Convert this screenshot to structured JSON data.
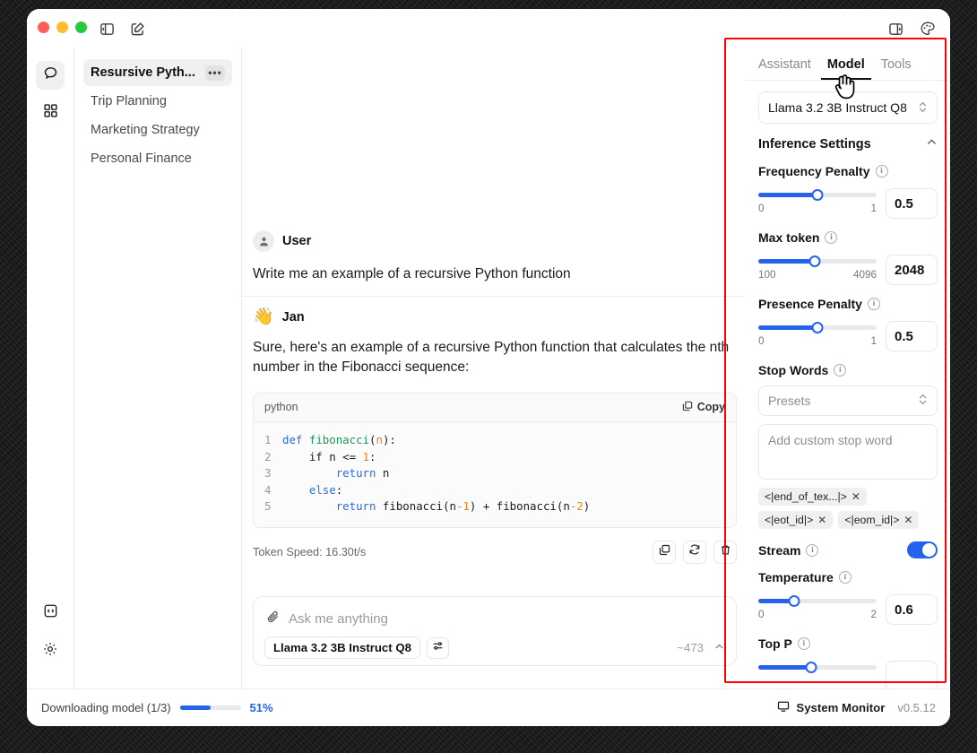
{
  "titlebar": {
    "icons": [
      "panel-left-icon",
      "compose-icon",
      "panel-right-icon",
      "palette-icon"
    ]
  },
  "rail": {
    "items": [
      {
        "name": "chat-icon",
        "active": true
      },
      {
        "name": "apps-grid-icon",
        "active": false
      }
    ],
    "bottom": [
      {
        "name": "code-icon"
      },
      {
        "name": "gear-icon"
      }
    ]
  },
  "threads": {
    "items": [
      {
        "label": "Resursive Pyth...",
        "active": true,
        "menu": "•••"
      },
      {
        "label": "Trip Planning",
        "active": false
      },
      {
        "label": "Marketing Strategy",
        "active": false
      },
      {
        "label": "Personal Finance",
        "active": false
      }
    ]
  },
  "chat": {
    "user": {
      "name": "User",
      "text": "Write me an example of a recursive Python function"
    },
    "assistant": {
      "emoji": "👋",
      "name": "Jan",
      "text": "Sure, here's an example of a recursive Python function that calculates the nth number in the Fibonacci sequence:",
      "code": {
        "language": "python",
        "copy_label": "Copy",
        "lines": [
          "1",
          "2",
          "3",
          "4",
          "5"
        ]
      },
      "token_speed": "Token Speed: 16.30t/s",
      "actions": [
        "copy-icon",
        "regenerate-icon",
        "delete-icon"
      ]
    }
  },
  "composer": {
    "placeholder": "Ask me anything",
    "model": "Llama 3.2 3B Instruct Q8",
    "token_count": "~473"
  },
  "panel": {
    "tabs": [
      {
        "label": "Assistant",
        "active": false
      },
      {
        "label": "Model",
        "active": true
      },
      {
        "label": "Tools",
        "active": false
      }
    ],
    "model_select": "Llama 3.2 3B Instruct Q8",
    "section_title": "Inference Settings",
    "settings": [
      {
        "label": "Frequency Penalty",
        "min": "0",
        "max": "1",
        "value": "0.5",
        "fill_pct": 50
      },
      {
        "label": "Max token",
        "min": "100",
        "max": "4096",
        "value": "2048",
        "fill_pct": 48
      },
      {
        "label": "Presence Penalty",
        "min": "0",
        "max": "1",
        "value": "0.5",
        "fill_pct": 50
      }
    ],
    "stop_words": {
      "label": "Stop Words",
      "presets_placeholder": "Presets",
      "input_placeholder": "Add custom stop word",
      "chips": [
        "<|end_of_tex...|>",
        "<|eot_id|>",
        "<|eom_id|>"
      ]
    },
    "stream": {
      "label": "Stream",
      "on": true
    },
    "temperature": {
      "label": "Temperature",
      "min": "0",
      "max": "2",
      "value": "0.6",
      "fill_pct": 30
    },
    "top_p": {
      "label": "Top P"
    }
  },
  "statusbar": {
    "download_text": "Downloading model (1/3)",
    "download_pct": "51%",
    "download_fill": 51,
    "system_monitor": "System Monitor",
    "version": "v0.5.12"
  },
  "colors": {
    "accent": "#2563eb",
    "highlight": "#ff0000"
  }
}
